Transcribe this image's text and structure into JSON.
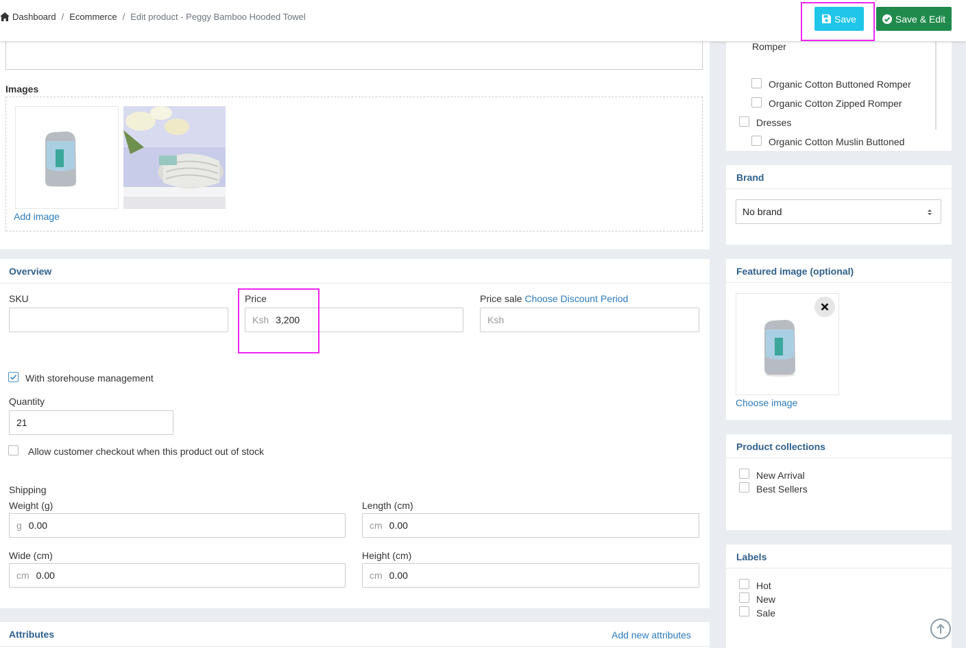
{
  "breadcrumb": {
    "home": "Dashboard",
    "section": "Ecommerce",
    "current": "Edit product - Peggy Bamboo Hooded Towel"
  },
  "toolbar": {
    "save_label": "Save",
    "save_edit_label": "Save & Edit"
  },
  "images": {
    "title": "Images",
    "add_image": "Add image"
  },
  "overview": {
    "title": "Overview",
    "sku_label": "SKU",
    "sku_value": "",
    "price_label": "Price",
    "price_prefix": "Ksh",
    "price_value": "3,200",
    "price_sale_label": "Price sale",
    "price_sale_link": "Choose Discount Period",
    "price_sale_prefix": "Ksh",
    "storehouse_label": "With storehouse management",
    "storehouse_checked": true,
    "quantity_label": "Quantity",
    "quantity_value": "21",
    "allow_checkout_label": "Allow customer checkout when this product out of stock",
    "shipping_label": "Shipping",
    "weight_label": "Weight (g)",
    "weight_prefix": "g",
    "weight_value": "0.00",
    "length_label": "Length (cm)",
    "length_prefix": "cm",
    "length_value": "0.00",
    "wide_label": "Wide (cm)",
    "wide_prefix": "cm",
    "wide_value": "0.00",
    "height_label": "Height (cm)",
    "height_prefix": "cm",
    "height_value": "0.00"
  },
  "attributes": {
    "title": "Attributes",
    "add_new": "Add new attributes"
  },
  "categories": {
    "items": [
      {
        "label": "Romper",
        "level": 1,
        "checkbox": false
      },
      {
        "label": "Organic Cotton Buttoned Romper",
        "level": 2,
        "checkbox": true
      },
      {
        "label": "Organic Cotton Zipped Romper",
        "level": 2,
        "checkbox": true
      },
      {
        "label": "Dresses",
        "level": 1,
        "checkbox": true
      },
      {
        "label": "Organic Cotton Muslin Buttoned",
        "level": 2,
        "checkbox": true
      }
    ]
  },
  "brand": {
    "title": "Brand",
    "selected": "No brand"
  },
  "featured_image": {
    "title": "Featured image (optional)",
    "choose": "Choose image"
  },
  "collections": {
    "title": "Product collections",
    "items": [
      "New Arrival",
      "Best Sellers"
    ]
  },
  "labels": {
    "title": "Labels",
    "items": [
      "Hot",
      "New",
      "Sale"
    ]
  },
  "colors": {
    "accent": "#1fc6e9",
    "success": "#1f8a4c",
    "highlight": "#ee24ee",
    "title": "#2d5f8b",
    "link": "#2b7bbd"
  }
}
